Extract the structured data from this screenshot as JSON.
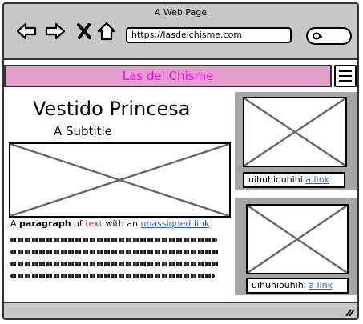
{
  "window": {
    "title": "A Web Page",
    "url": "https://lasdelchisme.com"
  },
  "nav": {
    "back_icon": "back-arrow-icon",
    "forward_icon": "forward-arrow-icon",
    "close_icon": "close-icon",
    "home_icon": "home-icon",
    "search_icon": "search-icon"
  },
  "site": {
    "header_title": "Las del Chisme",
    "header_color": "#e2a0cb",
    "header_text_color": "#ff00ff",
    "menu_icon": "hamburger-menu-icon"
  },
  "main": {
    "title": "Vestido Princesa",
    "subtitle": "A Subtitle",
    "paragraph": {
      "text_1": "A ",
      "bold": "paragraph",
      "text_2": " of ",
      "red": "text",
      "text_3": " with an ",
      "link": "unassigned link",
      "text_4": "."
    }
  },
  "sidebar": {
    "cards": [
      {
        "caption": "uihuhiouhihi",
        "link": "a link"
      },
      {
        "caption": "uihuhiouhihi",
        "link": "a link"
      }
    ]
  }
}
